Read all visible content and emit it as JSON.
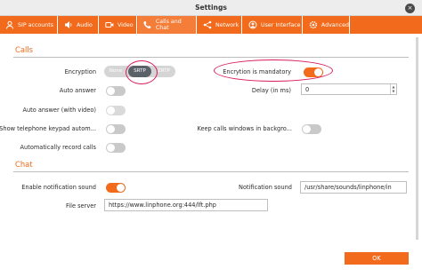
{
  "window": {
    "title": "Settings",
    "close_glyph": "×"
  },
  "tabs": [
    {
      "label": "SIP accounts",
      "icon": "user-icon"
    },
    {
      "label": "Audio",
      "icon": "speaker-icon"
    },
    {
      "label": "Video",
      "icon": "camera-icon"
    },
    {
      "label": "Calls and Chat",
      "icon": "phone-chat-icon",
      "active": true
    },
    {
      "label": "Network",
      "icon": "share-icon"
    },
    {
      "label": "User Interface",
      "icon": "monitor-icon"
    },
    {
      "label": "Advanced",
      "icon": "gear-icon"
    }
  ],
  "calls": {
    "title": "Calls",
    "encryption_label": "Encryption",
    "encryption_options": [
      "None",
      "SRTP",
      "ZRTP"
    ],
    "encryption_selected": "SRTP",
    "encryption_mandatory_label": "Encrytion is mandatory",
    "encryption_mandatory": true,
    "auto_answer_label": "Auto answer",
    "auto_answer": false,
    "delay_label": "Delay (in ms)",
    "delay_value": "0",
    "auto_answer_video_label": "Auto answer (with video)",
    "auto_answer_video": false,
    "show_keypad_label": "Show telephone keypad autom...",
    "show_keypad": false,
    "keep_calls_label": "Keep calls windows in backgro...",
    "keep_calls": false,
    "auto_record_label": "Automatically record calls",
    "auto_record": false
  },
  "chat": {
    "title": "Chat",
    "notification_sound_enable_label": "Enable notification sound",
    "notification_sound_enabled": true,
    "notification_sound_label": "Notification sound",
    "notification_sound_path": "/usr/share/sounds/linphone/in",
    "file_server_label": "File server",
    "file_server_url": "https://www.linphone.org:444/lft.php"
  },
  "footer": {
    "ok_label": "OK"
  },
  "colors": {
    "accent": "#f26a1b",
    "annotation": "#d81b60",
    "segment_selected": "#5a6169"
  }
}
